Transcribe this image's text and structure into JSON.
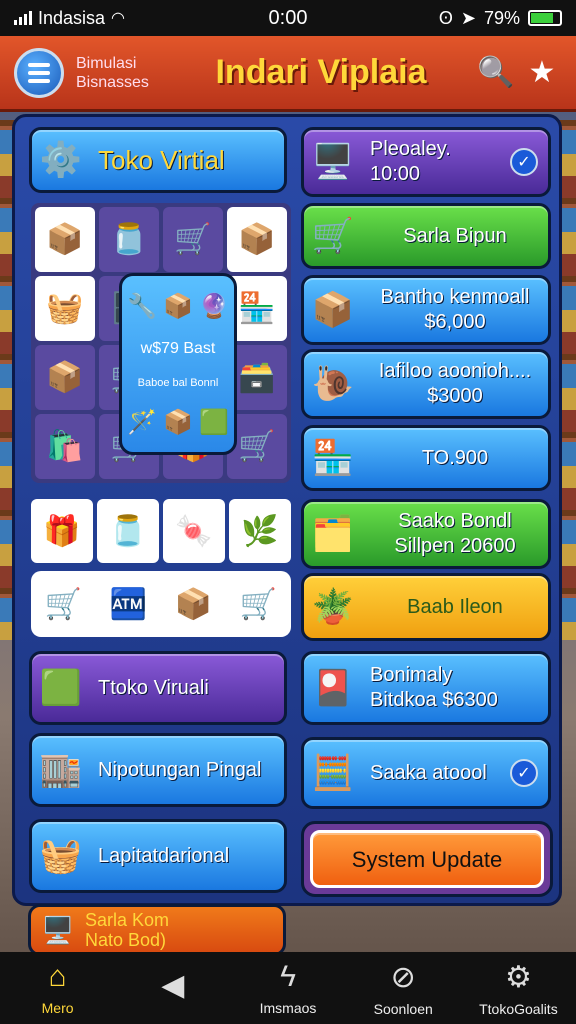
{
  "status": {
    "carrier": "Indasisa",
    "time": "0:00",
    "battery": "79%"
  },
  "header": {
    "brand_line1": "Bimulasi",
    "brand_line2": "Bisnasses",
    "title": "Indari Viplaia"
  },
  "left": {
    "toko_title": "Toko Virtial",
    "popup_value": "w$79 Bast",
    "popup_sub": "Baboe bal Bonnl",
    "tile_virual": "Ttoko Viruali",
    "tile_pingal": "Nipotungan Pingal",
    "tile_lapita": "Lapitatdarional",
    "tile_peek": "Sarla Kom\nNato Bod)"
  },
  "right": {
    "tile1": "Pleoaley. 10:00",
    "tile2": "Sarla Bipun",
    "tile3": "Bantho kenmoall\n$6,000",
    "tile4": "Iafiloo aoonioh....\n$3000",
    "tile5": "TO.900",
    "tile6": "Saako Bondl\nSillpen 20600",
    "tile7": "Baab Ileon",
    "tile8": "Bonimaly\nBitdkoa $6300",
    "tile9": "Saaka atoool",
    "system_update": "System Update"
  },
  "nav": [
    {
      "label": "Mero",
      "icon": "home-icon"
    },
    {
      "label": "",
      "icon": "back-icon"
    },
    {
      "label": "Imsmaos",
      "icon": "lightning-icon"
    },
    {
      "label": "Soonloen",
      "icon": "ban-icon"
    },
    {
      "label": "TtokoGoalits",
      "icon": "gear-icon"
    }
  ]
}
